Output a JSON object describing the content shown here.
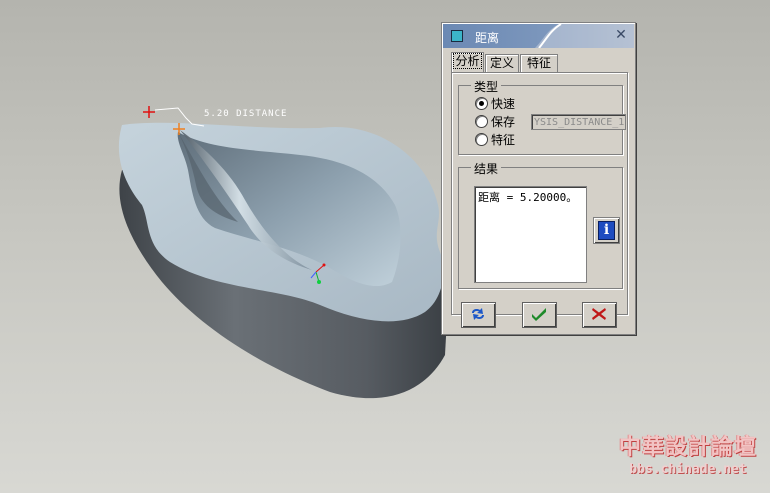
{
  "viewport": {
    "measurement_label": "5.20  DISTANCE"
  },
  "dialog": {
    "title": "距离",
    "tabs": [
      {
        "label": "分析",
        "active": true
      },
      {
        "label": "定义",
        "active": false
      },
      {
        "label": "特征",
        "active": false
      }
    ],
    "type_group": {
      "legend": "类型",
      "options": [
        {
          "label": "快速",
          "selected": true
        },
        {
          "label": "保存",
          "selected": false
        },
        {
          "label": "特征",
          "selected": false
        }
      ],
      "save_name_value": "YSIS_DISTANCE_1"
    },
    "result_group": {
      "legend": "结果",
      "text": "距离 = 5.20000。"
    },
    "buttons": {
      "repeat": "repeat-icon",
      "ok": "check-icon",
      "cancel": "x-icon"
    }
  },
  "watermark": {
    "chinese": "中華設計論壇",
    "url": "bbs.chinade.net"
  },
  "colors": {
    "titlebar": "#7e98bd",
    "dialog_bg": "#d4d0c8",
    "ok_green": "#1f8a2a",
    "cancel_red": "#c01818",
    "model_top": "#b8c8d2",
    "model_side": "#545a60"
  }
}
